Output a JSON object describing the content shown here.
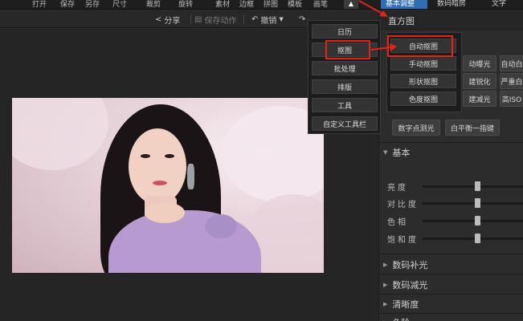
{
  "toolbar": {
    "items": [
      "打开",
      "保存",
      "另存",
      "尺寸",
      "裁剪",
      "旋转",
      "素材",
      "边框",
      "拼图",
      "模板",
      "画笔"
    ],
    "tabs": {
      "basic": "基本调整",
      "digital": "数码暗房",
      "text": "文字"
    }
  },
  "subbar": {
    "share": "分享",
    "save_action": "保存动作",
    "undo": "撤销"
  },
  "dropdown_menu": {
    "items": [
      "日历",
      "抠图",
      "批处理",
      "排版",
      "工具",
      "自定义工具栏"
    ]
  },
  "submenu": {
    "items": [
      "自动抠图",
      "手动抠图",
      "形状抠图",
      "色度抠图"
    ]
  },
  "right_panel": {
    "histogram_label": "直方图",
    "quick_buttons": [
      "动曝光",
      "自动白",
      "建锐化",
      "严重白",
      "建减光",
      "高ISO"
    ],
    "buttons": [
      "数字点测光",
      "白平衡一指键"
    ],
    "basic_section": "基本",
    "sliders": [
      {
        "label": "亮度",
        "value": 0
      },
      {
        "label": "对比度",
        "value": 0
      },
      {
        "label": "色相",
        "value": 0
      },
      {
        "label": "饱和度",
        "value": 0
      }
    ],
    "sections": [
      "数码补光",
      "数码减光",
      "清晰度",
      "色阶"
    ]
  },
  "colors": {
    "accent": "#2f6db5",
    "highlight": "#e2231a",
    "arrow": "#e2231a"
  }
}
